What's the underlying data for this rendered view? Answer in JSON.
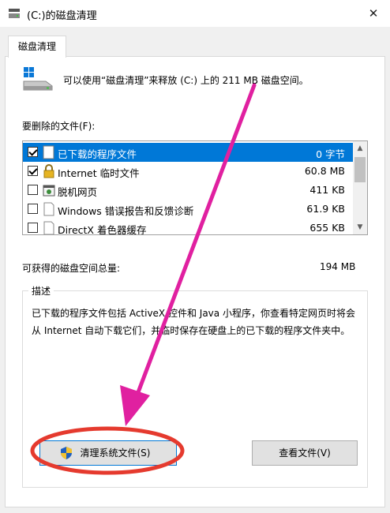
{
  "window": {
    "title": "(C:)的磁盘清理",
    "close_glyph": "✕"
  },
  "tabs": [
    {
      "label": "磁盘清理"
    }
  ],
  "intro_text": "可以使用“磁盘清理”来释放 (C:) 上的 211 MB 磁盘空间。",
  "files_label": "要删除的文件(F):",
  "files": [
    {
      "checked": true,
      "icon": "folder-icon",
      "name": "已下载的程序文件",
      "size": "0 字节",
      "selected": true
    },
    {
      "checked": true,
      "icon": "lock-icon",
      "name": "Internet 临时文件",
      "size": "60.8 MB"
    },
    {
      "checked": false,
      "icon": "offline-page-icon",
      "name": "脱机网页",
      "size": "411 KB"
    },
    {
      "checked": false,
      "icon": "document-icon",
      "name": "Windows 错误报告和反馈诊断",
      "size": "61.9 KB"
    },
    {
      "checked": false,
      "icon": "document-icon",
      "name": "DirectX 着色器缓存",
      "size": "655 KB"
    }
  ],
  "total_label": "可获得的磁盘空间总量:",
  "total_value": "194 MB",
  "description_title": "描述",
  "description_text": "已下载的程序文件包括 ActiveX 控件和 Java 小程序，你查看特定网页时将会从 Internet 自动下载它们，并临时保存在硬盘上的已下载的程序文件夹中。",
  "buttons": {
    "clean_system": "清理系统文件(S)",
    "view_files": "查看文件(V)"
  },
  "colors": {
    "selection": "#0078d7",
    "annotation": "#e0208e",
    "highlight_ring": "#e53a2e"
  }
}
